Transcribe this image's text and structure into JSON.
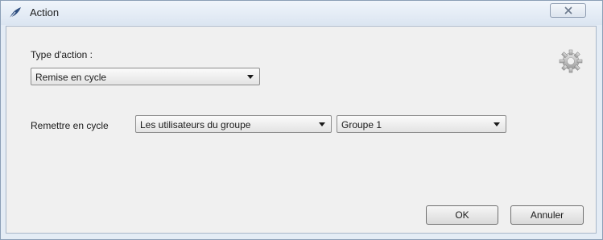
{
  "window": {
    "title": "Action"
  },
  "form": {
    "action_type_label": "Type d'action :",
    "action_type_value": "Remise en cycle",
    "recycle_label": "Remettre en cycle",
    "target_value": "Les utilisateurs du groupe",
    "group_value": "Groupe 1"
  },
  "buttons": {
    "ok": "OK",
    "cancel": "Annuler"
  },
  "icons": {
    "title": "feather-pen-icon",
    "settings": "gear-icon",
    "close": "close-icon"
  }
}
